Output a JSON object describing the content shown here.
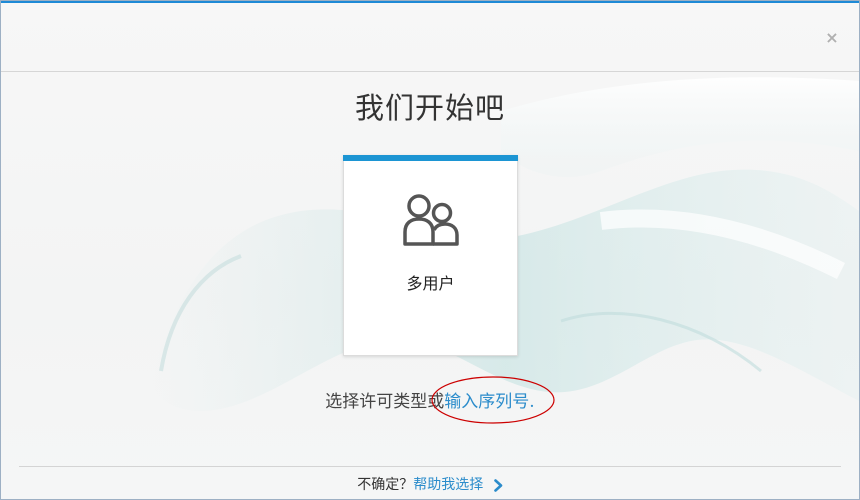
{
  "window": {
    "close_label": "×"
  },
  "main": {
    "title": "我们开始吧",
    "card": {
      "label": "多用户",
      "icon": "users-icon"
    },
    "license": {
      "prefix": "选择许可类型或",
      "link": "输入序列号",
      "suffix": "."
    }
  },
  "footer": {
    "question": "不确定？",
    "help_link": "帮助我选择",
    "chevron_icon": "chevron-right-icon"
  },
  "colors": {
    "accent": "#1c95d3",
    "link": "#2b8ccb",
    "annotation": "#cc0000"
  }
}
